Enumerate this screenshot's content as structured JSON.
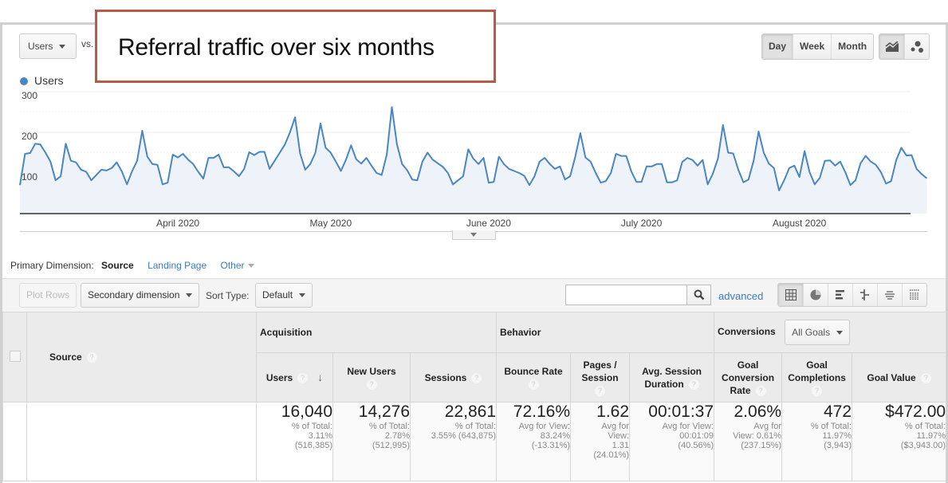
{
  "callout": "Referral traffic over six months",
  "metric_selector": {
    "value": "Users",
    "vs_label": "vs."
  },
  "period_buttons": [
    {
      "label": "Day",
      "active": true
    },
    {
      "label": "Week",
      "active": false
    },
    {
      "label": "Month",
      "active": false
    }
  ],
  "chart_view_buttons": [
    {
      "icon": "line-chart-icon",
      "active": true
    },
    {
      "icon": "motion-chart-icon",
      "active": false
    }
  ],
  "chart_data": {
    "type": "area",
    "title": "",
    "legend": [
      "Users"
    ],
    "legend_position": "top-left",
    "series_color": "#4a86c0",
    "fill_color": "#edf3f9",
    "xlabel": "",
    "ylabel": "",
    "ylim": [
      0,
      300
    ],
    "y_ticks": [
      100,
      200,
      300
    ],
    "grid": true,
    "x_tick_labels": [
      "April 2020",
      "May 2020",
      "June 2020",
      "July 2020",
      "August 2020"
    ],
    "x_tick_days": [
      31,
      61,
      92,
      122,
      153
    ],
    "start_date": "2020-03-01",
    "series": [
      {
        "name": "Users",
        "values": [
          70,
          147,
          149,
          172,
          170,
          150,
          128,
          82,
          92,
          172,
          130,
          126,
          108,
          103,
          82,
          95,
          108,
          106,
          112,
          126,
          104,
          72,
          104,
          130,
          204,
          140,
          122,
          120,
          72,
          76,
          145,
          138,
          147,
          133,
          122,
          103,
          86,
          137,
          137,
          145,
          114,
          114,
          104,
          92,
          110,
          151,
          144,
          152,
          152,
          110,
          130,
          150,
          170,
          200,
          237,
          148,
          108,
          122,
          150,
          222,
          162,
          150,
          128,
          105,
          133,
          168,
          134,
          123,
          137,
          118,
          100,
          95,
          145,
          262,
          170,
          122,
          107,
          84,
          82,
          128,
          150,
          133,
          124,
          115,
          100,
          72,
          82,
          92,
          158,
          135,
          122,
          137,
          76,
          78,
          140,
          122,
          110,
          105,
          100,
          93,
          70,
          92,
          128,
          137,
          122,
          110,
          116,
          84,
          92,
          140,
          198,
          138,
          128,
          100,
          76,
          80,
          100,
          147,
          142,
          142,
          104,
          78,
          78,
          116,
          116,
          122,
          122,
          77,
          77,
          82,
          127,
          137,
          132,
          118,
          132,
          72,
          98,
          135,
          218,
          150,
          148,
          108,
          77,
          84,
          130,
          202,
          150,
          123,
          112,
          57,
          82,
          112,
          118,
          90,
          154,
          102,
          72,
          88,
          130,
          131,
          118,
          128,
          102,
          70,
          82,
          124,
          142,
          128,
          120,
          102,
          74,
          80,
          132,
          162,
          143,
          144,
          110,
          97,
          87
        ]
      }
    ]
  },
  "primary_dimension": {
    "label": "Primary Dimension:",
    "active": "Source",
    "links": [
      "Landing Page",
      "Other"
    ]
  },
  "toolbar": {
    "plot_rows": "Plot Rows",
    "secondary_dimension": "Secondary dimension",
    "sort_type_label": "Sort Type:",
    "sort_type_value": "Default",
    "search_value": "",
    "advanced": "advanced",
    "viz_icons": [
      "table-icon",
      "pie-icon",
      "bar-icon",
      "comparison-icon",
      "term-cloud-icon",
      "pivot-icon"
    ]
  },
  "table": {
    "dimension_header": "Source",
    "groups": {
      "acquisition": "Acquisition",
      "behavior": "Behavior",
      "conversions": "Conversions",
      "goals_select": "All Goals"
    },
    "columns": [
      {
        "label": "Users",
        "sorted": true
      },
      {
        "label": "New Users"
      },
      {
        "label": "Sessions"
      },
      {
        "label": "Bounce Rate"
      },
      {
        "label": "Pages / Session"
      },
      {
        "label": "Avg. Session Duration"
      },
      {
        "label": "Goal Conversion Rate"
      },
      {
        "label": "Goal Completions"
      },
      {
        "label": "Goal Value"
      }
    ],
    "totals": [
      {
        "value": "16,040",
        "sub": [
          "% of Total:",
          "3.11%",
          "(516,385)"
        ]
      },
      {
        "value": "14,276",
        "sub": [
          "% of Total:",
          "2.78%",
          "(512,995)"
        ]
      },
      {
        "value": "22,861",
        "sub": [
          "% of Total:",
          "3.55% (643,875)"
        ]
      },
      {
        "value": "72.16%",
        "sub": [
          "Avg for View:",
          "83.24%",
          "(-13.31%)"
        ]
      },
      {
        "value": "1.62",
        "sub": [
          "Avg for",
          "View:",
          "1.31",
          "(24.01%)"
        ]
      },
      {
        "value": "00:01:37",
        "sub": [
          "Avg for View:",
          "00:01:09",
          "(40.56%)"
        ]
      },
      {
        "value": "2.06%",
        "sub": [
          "Avg for",
          "View: 0.61%",
          "(237.15%)"
        ]
      },
      {
        "value": "472",
        "sub": [
          "% of Total:",
          "11.97%",
          "(3,943)"
        ]
      },
      {
        "value": "$472.00",
        "sub": [
          "% of Total:",
          "11.97%",
          "($3,943.00)"
        ]
      }
    ]
  }
}
